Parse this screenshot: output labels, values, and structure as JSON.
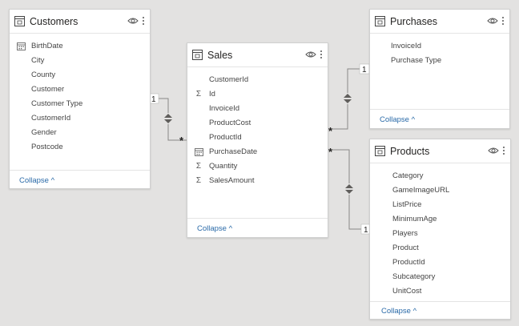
{
  "tables": {
    "customers": {
      "title": "Customers",
      "fields": [
        "BirthDate",
        "City",
        "County",
        "Customer",
        "Customer Type",
        "CustomerId",
        "Gender",
        "Postcode"
      ],
      "collapse": "Collapse ^"
    },
    "sales": {
      "title": "Sales",
      "fields": [
        "CustomerId",
        "Id",
        "InvoiceId",
        "ProductCost",
        "ProductId",
        "PurchaseDate",
        "Quantity",
        "SalesAmount"
      ],
      "collapse": "Collapse ^"
    },
    "purchases": {
      "title": "Purchases",
      "fields": [
        "InvoiceId",
        "Purchase Type"
      ],
      "collapse": "Collapse ^"
    },
    "products": {
      "title": "Products",
      "fields": [
        "Category",
        "GameImageURL",
        "ListPrice",
        "MinimumAge",
        "Players",
        "Product",
        "ProductId",
        "Subcategory",
        "UnitCost"
      ],
      "collapse": "Collapse ^"
    }
  },
  "relationships": {
    "customers_sales": {
      "from": "1",
      "to": "*"
    },
    "purchases_sales": {
      "from": "1",
      "to": "*"
    },
    "products_sales": {
      "from": "1",
      "to": "*"
    }
  },
  "icons": {
    "table": "table-icon",
    "visibility": "eye-icon",
    "more": "more-options-icon",
    "calendar": "calendar-icon",
    "sigma": "sigma-icon",
    "filter_direction": "both-direction-arrows-icon"
  }
}
